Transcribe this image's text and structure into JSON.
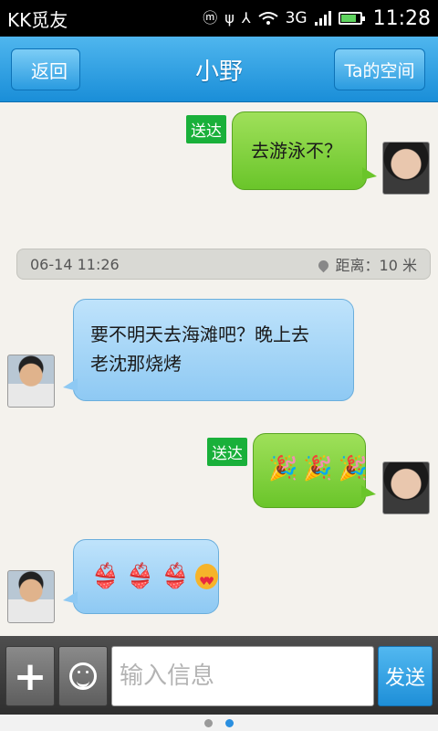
{
  "status_bar": {
    "app_name": "KK觅友",
    "network": "3G",
    "time": "11:28",
    "battery_level": 0.85
  },
  "header": {
    "back_label": "返回",
    "title": "小野",
    "space_label": "Ta的空间"
  },
  "messages": [
    {
      "side": "right",
      "status": "送达",
      "text": "去游泳不？"
    },
    {
      "side": "left",
      "text_line1": "要不明天去海滩吧？晚上去",
      "text_line2": "老沈那烧烤"
    },
    {
      "side": "right",
      "status": "送达",
      "emoji": [
        "party-popper",
        "party-popper",
        "party-popper"
      ]
    },
    {
      "side": "left",
      "emoji": [
        "bikini",
        "bikini",
        "bikini",
        "heart-eyes"
      ]
    }
  ],
  "info_bar": {
    "datetime": "06-14 11:26",
    "distance": "距离：10 米"
  },
  "input_bar": {
    "placeholder": "输入信息",
    "send_label": "发送"
  },
  "pager": {
    "pages": 2,
    "current": 2
  }
}
